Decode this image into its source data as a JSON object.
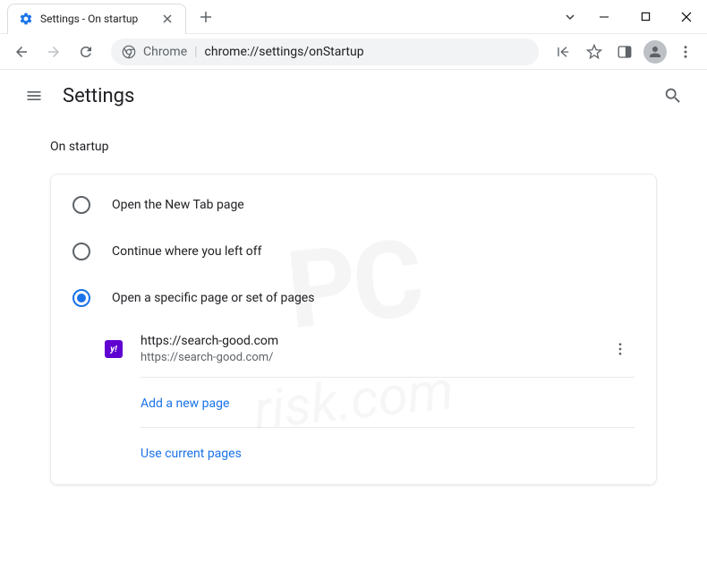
{
  "window": {
    "tab_title": "Settings - On startup"
  },
  "omnibox": {
    "prefix": "Chrome",
    "url": "chrome://settings/onStartup"
  },
  "header": {
    "title": "Settings"
  },
  "section": {
    "title": "On startup"
  },
  "options": {
    "newtab": "Open the New Tab page",
    "continue": "Continue where you left off",
    "specific": "Open a specific page or set of pages"
  },
  "page": {
    "favicon_text": "y!",
    "title": "https://search-good.com",
    "url": "https://search-good.com/"
  },
  "actions": {
    "add_page": "Add a new page",
    "use_current": "Use current pages"
  },
  "watermark": {
    "main": "PC",
    "sub": "risk.com"
  }
}
